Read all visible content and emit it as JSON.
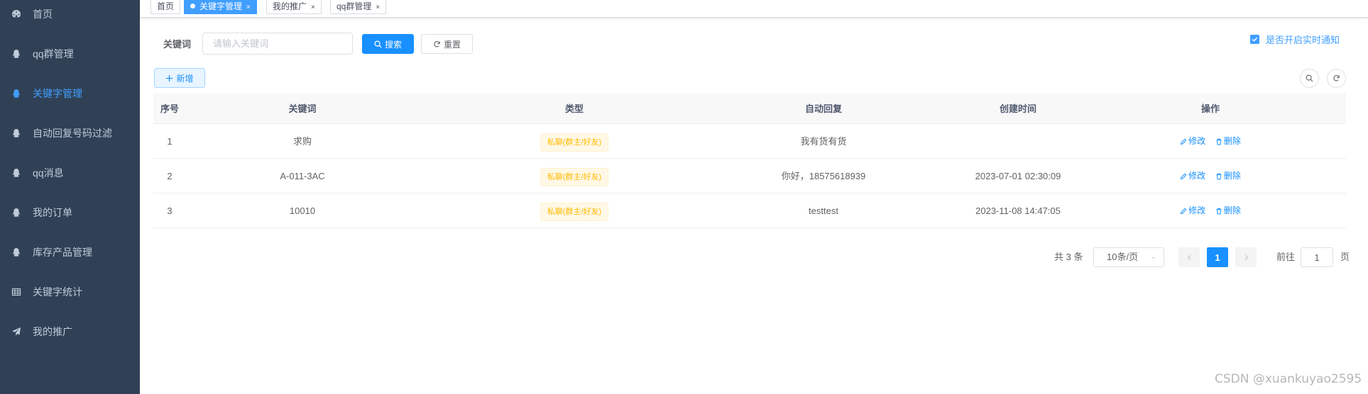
{
  "sidebar": {
    "items": [
      {
        "label": "首页",
        "icon": "dashboard-icon"
      },
      {
        "label": "qq群管理",
        "icon": "qq-icon"
      },
      {
        "label": "关键字管理",
        "icon": "qq-icon",
        "active": true
      },
      {
        "label": "自动回复号码过滤",
        "icon": "qq-icon"
      },
      {
        "label": "qq消息",
        "icon": "qq-icon"
      },
      {
        "label": "我的订单",
        "icon": "qq-icon"
      },
      {
        "label": "库存产品管理",
        "icon": "qq-icon"
      },
      {
        "label": "关键字统计",
        "icon": "table-icon"
      },
      {
        "label": "我的推广",
        "icon": "send-icon"
      }
    ]
  },
  "tags": [
    {
      "label": "首页"
    },
    {
      "label": "关键字管理",
      "active": true
    },
    {
      "label": "我的推广"
    },
    {
      "label": "qq群管理"
    }
  ],
  "tag_close": "×",
  "search": {
    "label": "关键词",
    "placeholder": "请输入关键词",
    "search_button": "搜索",
    "reset_button": "重置"
  },
  "notify_label": "是否开启实时通知",
  "add_button": "新增",
  "table": {
    "columns": [
      "序号",
      "关键词",
      "类型",
      "自动回复",
      "创建时间",
      "操作"
    ],
    "rows": [
      {
        "index": "1",
        "keyword": "求购",
        "type": "私聊(群主/好友)",
        "reply": "我有货有货",
        "created": ""
      },
      {
        "index": "2",
        "keyword": "A-011-3AC",
        "type": "私聊(群主/好友)",
        "reply": "你好，18575618939",
        "created": "2023-07-01 02:30:09"
      },
      {
        "index": "3",
        "keyword": "10010",
        "type": "私聊(群主/好友)",
        "reply": "testtest",
        "created": "2023-11-08 14:47:05"
      }
    ],
    "edit_label": "修改",
    "delete_label": "删除"
  },
  "pagination": {
    "total": "共 3 条",
    "page_size": "10条/页",
    "current_page": "1",
    "goto_prefix": "前往",
    "goto_value": "1",
    "goto_suffix": "页"
  },
  "watermark": "CSDN @xuankuyao2595",
  "colors": {
    "sidebar_bg": "#304156",
    "sidebar_text": "#bfcbd9",
    "accent": "#1890ff",
    "type_tag": "#ffba00"
  }
}
